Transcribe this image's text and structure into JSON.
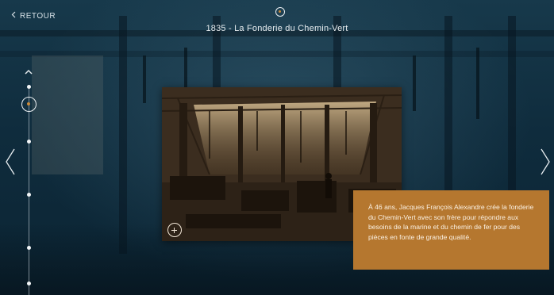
{
  "header": {
    "back_label": "RETOUR",
    "title": "1835 - La Fonderie du Chemin-Vert"
  },
  "caption": {
    "text": "À 46 ans, Jacques François Alexandre crée la fonderie du Chemin-Vert avec son frère pour répondre aux besoins de la marine et du chemin de fer pour des pièces en fonte de grande qualité."
  },
  "timeline": {
    "active_index": 0,
    "dot_count": 6
  },
  "icons": {
    "back": "chevron-left-icon",
    "timeline_up": "chevron-up-icon",
    "prev": "chevron-left-icon",
    "next": "chevron-right-icon",
    "zoom": "plus-circle-icon"
  },
  "colors": {
    "accent": "#b5772f",
    "marker_dot": "#c98a3a",
    "background": "#0f2c3d",
    "text": "#e6ecef"
  }
}
